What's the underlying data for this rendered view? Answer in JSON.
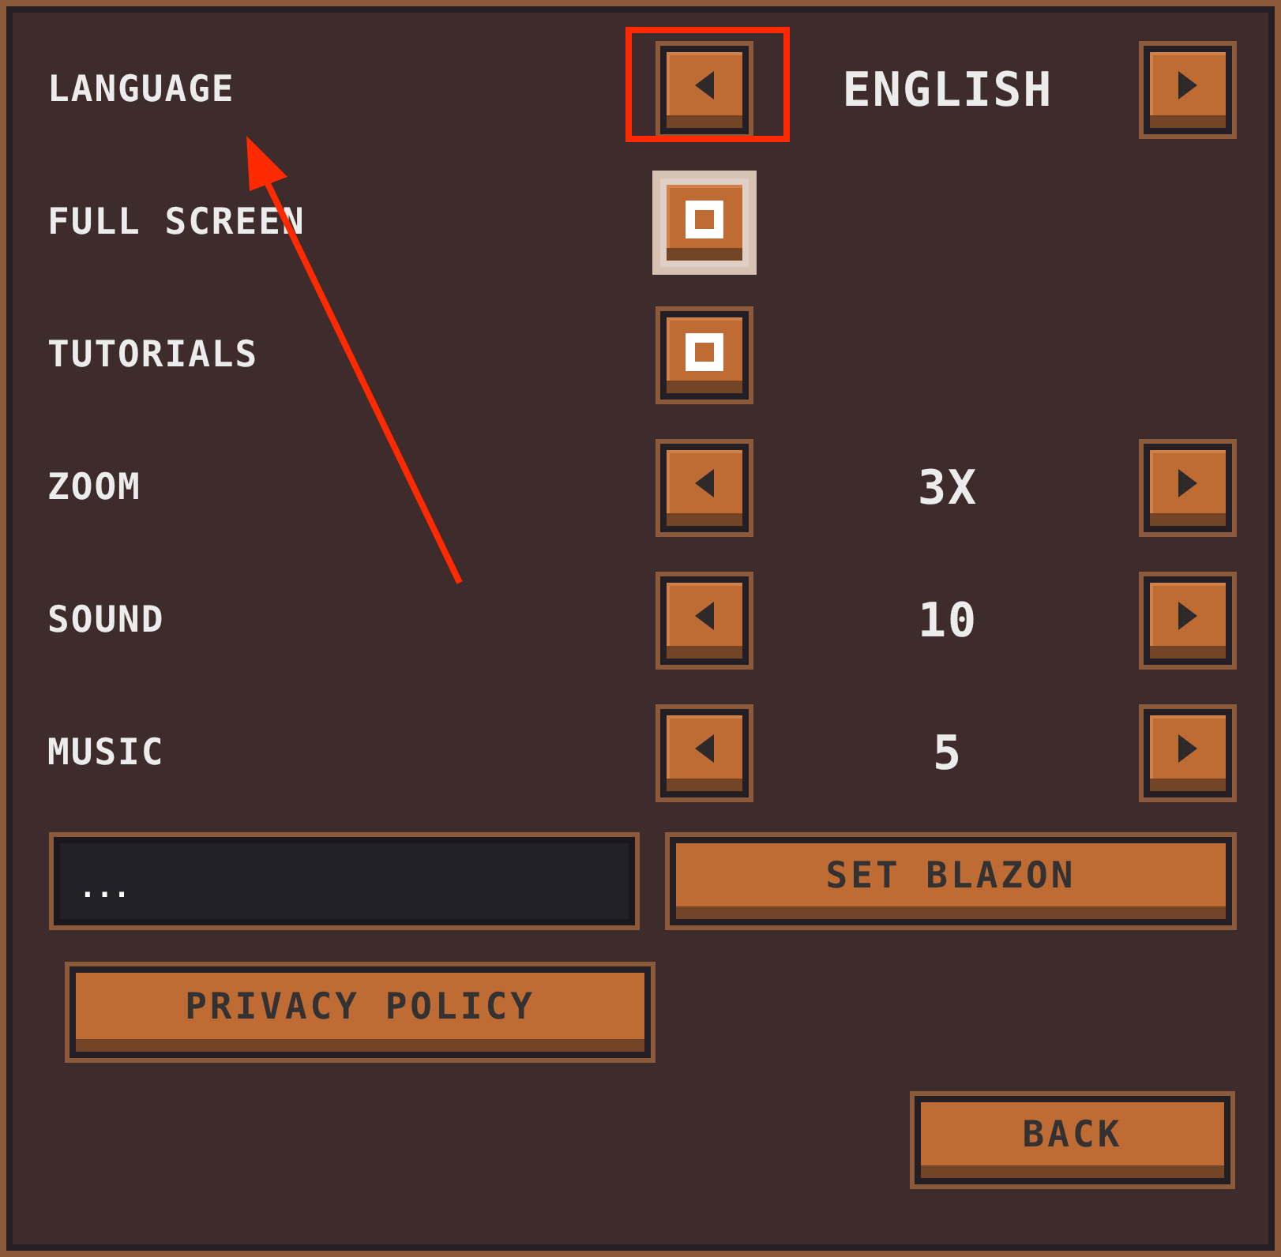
{
  "settings": [
    {
      "kind": "selector",
      "label": "LANGUAGE",
      "value": "ENGLISH"
    },
    {
      "kind": "checkbox",
      "label": "FULL SCREEN",
      "checked": true,
      "focused": true
    },
    {
      "kind": "checkbox",
      "label": "TUTORIALS",
      "checked": true,
      "focused": false
    },
    {
      "kind": "selector",
      "label": "ZOOM",
      "value": "3X"
    },
    {
      "kind": "selector",
      "label": "SOUND",
      "value": "10"
    },
    {
      "kind": "selector",
      "label": "MUSIC",
      "value": "5"
    }
  ],
  "name_field": {
    "value": "..."
  },
  "blazon_button": "SET BLAZON",
  "privacy_button": "PRIVACY POLICY",
  "back_button": "BACK",
  "annotation": {
    "highlight": true,
    "arrow": true
  }
}
